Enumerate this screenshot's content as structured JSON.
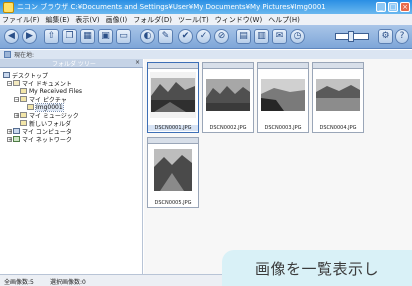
{
  "window": {
    "title": "ニコン ブラウザ C:¥Documents and Settings¥User¥My Documents¥My Pictures¥Img0001",
    "controls": [
      "_",
      "□",
      "×"
    ]
  },
  "menu": [
    "ファイル(F)",
    "編集(E)",
    "表示(V)",
    "画像(I)",
    "フォルダ(D)",
    "ツール(T)",
    "ウィンドウ(W)",
    "ヘルプ(H)"
  ],
  "address": {
    "label": "現在地:"
  },
  "tree": {
    "header": "フォルダ ツリー",
    "close": "×",
    "items": [
      {
        "label": "デスクトップ"
      },
      {
        "label": "マイ ドキュメント"
      },
      {
        "label": "My Received Files"
      },
      {
        "label": "マイ ピクチャ"
      },
      {
        "label": "Img0001"
      },
      {
        "label": "マイ ミュージック"
      },
      {
        "label": "新しいフォルダ"
      },
      {
        "label": "マイ コンピュータ"
      },
      {
        "label": "マイ ネットワーク"
      }
    ]
  },
  "thumbnails": [
    {
      "name": "DSCN0001.JPG",
      "selected": true
    },
    {
      "name": "DSCN0002.JPG"
    },
    {
      "name": "DSCN0003.JPG"
    },
    {
      "name": "DSCN0004.JPG"
    },
    {
      "name": "DSCN0005.JPG"
    }
  ],
  "status": {
    "total": "全画像数:5",
    "selected": "選択画像数:0"
  },
  "caption": "画像を一覧表示し"
}
